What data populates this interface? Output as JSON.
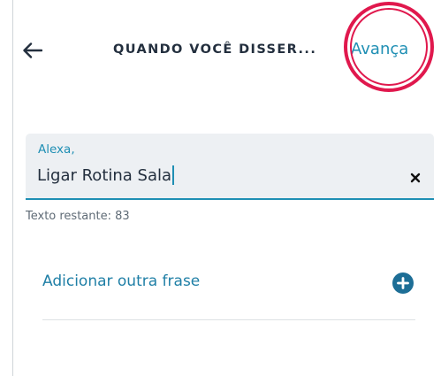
{
  "header": {
    "title": "QUANDO VOCÊ DISSER...",
    "next_label": "Avança",
    "back_icon": "arrow-left-icon"
  },
  "phrase_field": {
    "label": "Alexa,",
    "value": "Ligar Rotina Sala",
    "clear_icon": "close-icon"
  },
  "remaining": "Texto restante: 83",
  "add_phrase": {
    "label": "Adicionar outra frase",
    "icon": "plus-circle-icon"
  },
  "colors": {
    "accent": "#1f8fb4",
    "highlight": "#e0184d",
    "text_dark": "#232f3e",
    "field_bg": "#edf0f3"
  }
}
